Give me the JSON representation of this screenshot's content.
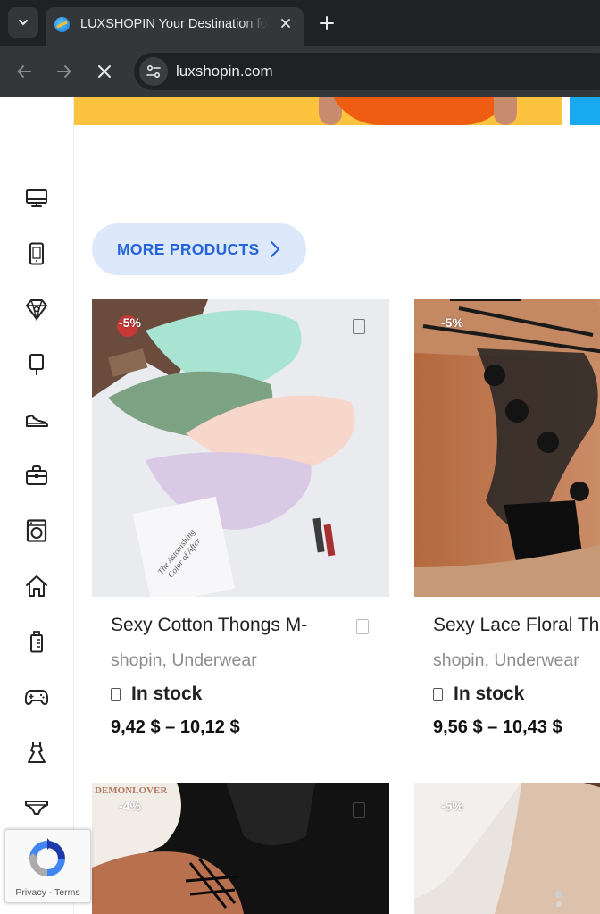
{
  "browser": {
    "tab_title": "LUXSHOPIN Your Destination for",
    "url": "luxshopin.com"
  },
  "sidebar": {
    "categories": [
      {
        "icon": "monitor-icon"
      },
      {
        "icon": "tablet-icon"
      },
      {
        "icon": "jewelry-icon"
      },
      {
        "icon": "popsicle-icon"
      },
      {
        "icon": "sneaker-icon"
      },
      {
        "icon": "bag-icon"
      },
      {
        "icon": "washing-machine-icon"
      },
      {
        "icon": "home-icon"
      },
      {
        "icon": "baby-bottle-icon"
      },
      {
        "icon": "gamepad-icon"
      },
      {
        "icon": "dress-icon"
      },
      {
        "icon": "underwear-icon"
      }
    ]
  },
  "more_products": {
    "label": "MORE PRODUCTS"
  },
  "products": [
    {
      "badge": "-5%",
      "title": "Sexy Cotton Thongs M-",
      "vendor": "shopin",
      "separator": ", ",
      "category": "Underwear",
      "stock": "In stock",
      "price": "9,42 $ – 10,12 $"
    },
    {
      "badge": "-5%",
      "title": "Sexy Lace Floral Th",
      "vendor": "shopin",
      "separator": ", ",
      "category": "Underwear",
      "stock": "In stock",
      "price": "9,56 $ – 10,43 $"
    },
    {
      "badge": "-4%",
      "image_text": "DEMONLOVER"
    },
    {
      "badge": "-5%"
    }
  ],
  "product_image_text": "The Astonishing Color of After",
  "recaptcha": {
    "privacy": "Privacy",
    "dash": " - ",
    "terms": "Terms"
  },
  "colors": {
    "accent": "#2565d8",
    "accent_bg": "#dde8fb",
    "chrome_dark": "#202124",
    "chrome_mid": "#35363a"
  }
}
